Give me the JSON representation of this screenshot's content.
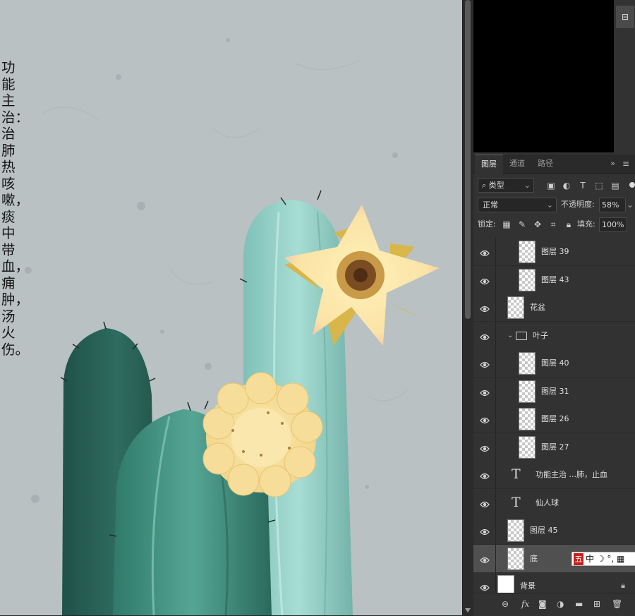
{
  "canvas": {
    "vertical_text": [
      "功能主治：",
      "治肺热咳嗽，",
      "痰中带血，",
      "痈肿，",
      "汤火伤。"
    ]
  },
  "navigator": {
    "button_icon": "navigator-toggle-icon"
  },
  "tabs": [
    {
      "label": "图层",
      "active": true
    },
    {
      "label": "通道",
      "active": false
    },
    {
      "label": "路径",
      "active": false
    }
  ],
  "tabs_more": "»",
  "tabs_menu": "≡",
  "filter": {
    "kind": "类型"
  },
  "blend": {
    "mode": "正常",
    "opacity_label": "不透明度:",
    "opacity": "58%"
  },
  "lock": {
    "label": "锁定:",
    "fill_label": "填充:",
    "fill": "100%"
  },
  "layers": [
    {
      "name": "图层 39",
      "type": "pixel",
      "indent": 2
    },
    {
      "name": "图层 43",
      "type": "pixel",
      "indent": 2
    },
    {
      "name": "花盆",
      "type": "pixel",
      "indent": 1
    },
    {
      "name": "叶子",
      "type": "group",
      "indent": 1
    },
    {
      "name": "图层 40",
      "type": "pixel",
      "indent": 2
    },
    {
      "name": "图层 31",
      "type": "pixel",
      "indent": 2
    },
    {
      "name": "图层 26",
      "type": "pixel",
      "indent": 2
    },
    {
      "name": "图层 27",
      "type": "pixel",
      "indent": 2
    },
    {
      "name": "功能主治 ...肺，止血",
      "type": "text",
      "indent": 1
    },
    {
      "name": "仙人球",
      "type": "text",
      "indent": 1
    },
    {
      "name": "图层 45",
      "type": "pixel",
      "indent": 1
    },
    {
      "name": "底",
      "type": "pixel",
      "indent": 1,
      "selected": true
    },
    {
      "name": "背景",
      "type": "background",
      "indent": 0,
      "locked": true
    }
  ],
  "ime": {
    "badge": "五",
    "text": "中 ☽ °, ▦"
  },
  "footer": [
    "link-icon",
    "fx",
    "mask-icon",
    "adjustment-icon",
    "folder-icon",
    "new-layer-icon",
    "trash-icon"
  ],
  "colors": {
    "panel": "#323232",
    "canvas_paper": "#b9c1c3",
    "cactus_dark": "#2f6b5f",
    "cactus_light": "#8fcfc6",
    "flower": "#f6dd9a"
  }
}
